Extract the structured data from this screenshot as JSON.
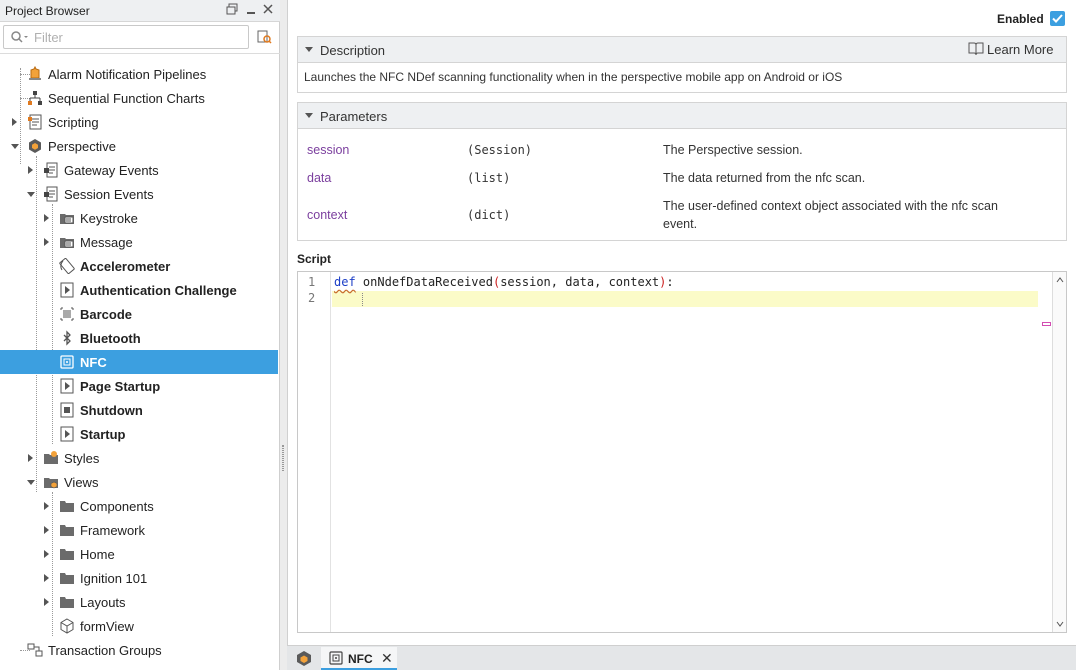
{
  "project_browser": {
    "title": "Project Browser",
    "filter_placeholder": "Filter",
    "tree": [
      {
        "label": "Alarm Notification Pipelines",
        "bold": false,
        "icon": "alarm-pipeline-icon"
      },
      {
        "label": "Sequential Function Charts",
        "bold": false,
        "icon": "sfc-icon"
      },
      {
        "label": "Scripting",
        "bold": false,
        "icon": "scripting-icon"
      },
      {
        "label": "Perspective",
        "bold": false,
        "icon": "perspective-icon"
      },
      {
        "label": "Gateway Events",
        "bold": false,
        "icon": "event-script-icon"
      },
      {
        "label": "Session Events",
        "bold": false,
        "icon": "event-script-icon"
      },
      {
        "label": "Keystroke",
        "bold": false,
        "icon": "script-folder-icon"
      },
      {
        "label": "Message",
        "bold": false,
        "icon": "script-folder-icon"
      },
      {
        "label": "Accelerometer",
        "bold": true,
        "icon": "accelerometer-icon"
      },
      {
        "label": "Authentication Challenge",
        "bold": true,
        "icon": "script-icon"
      },
      {
        "label": "Barcode",
        "bold": true,
        "icon": "barcode-icon"
      },
      {
        "label": "Bluetooth",
        "bold": true,
        "icon": "bluetooth-icon"
      },
      {
        "label": "NFC",
        "bold": true,
        "icon": "nfc-icon",
        "selected": true
      },
      {
        "label": "Page Startup",
        "bold": true,
        "icon": "script-icon"
      },
      {
        "label": "Shutdown",
        "bold": true,
        "icon": "script-icon"
      },
      {
        "label": "Startup",
        "bold": true,
        "icon": "script-icon"
      },
      {
        "label": "Styles",
        "bold": false,
        "icon": "styles-folder-icon"
      },
      {
        "label": "Views",
        "bold": false,
        "icon": "views-folder-icon"
      },
      {
        "label": "Components",
        "bold": false,
        "icon": "folder-icon"
      },
      {
        "label": "Framework",
        "bold": false,
        "icon": "folder-icon"
      },
      {
        "label": "Home",
        "bold": false,
        "icon": "folder-icon"
      },
      {
        "label": "Ignition 101",
        "bold": false,
        "icon": "folder-icon"
      },
      {
        "label": "Layouts",
        "bold": false,
        "icon": "folder-icon"
      },
      {
        "label": "formView",
        "bold": false,
        "icon": "view-icon"
      },
      {
        "label": "Transaction Groups",
        "bold": false,
        "icon": "transaction-groups-icon"
      }
    ]
  },
  "editor": {
    "enabled_label": "Enabled",
    "enabled": true,
    "description": {
      "title": "Description",
      "learn_more": "Learn More",
      "text": "Launches the NFC NDef scanning functionality when in the perspective mobile app on Android or iOS"
    },
    "parameters": {
      "title": "Parameters",
      "rows": [
        {
          "name": "session",
          "type": "(Session)",
          "desc": "The Perspective session."
        },
        {
          "name": "data",
          "type": "(list)",
          "desc": "The data returned from the nfc scan."
        },
        {
          "name": "context",
          "type": "(dict)",
          "desc": "The user-defined context object associated with the nfc scan event."
        }
      ]
    },
    "script": {
      "label": "Script",
      "line_numbers": [
        "1",
        "2"
      ],
      "keyword": "def",
      "function_name": "onNdefDataReceived",
      "open_paren": "(",
      "args": "session, data, context",
      "close_paren": ")",
      "colon": ":"
    }
  },
  "tabs": {
    "active_label": "NFC",
    "close_glyph": "✕"
  },
  "colors": {
    "accent": "#3c9fe0",
    "param_name": "#7b3f9e",
    "keyword": "#1c3ec6",
    "current_line": "#fbfbc8"
  }
}
